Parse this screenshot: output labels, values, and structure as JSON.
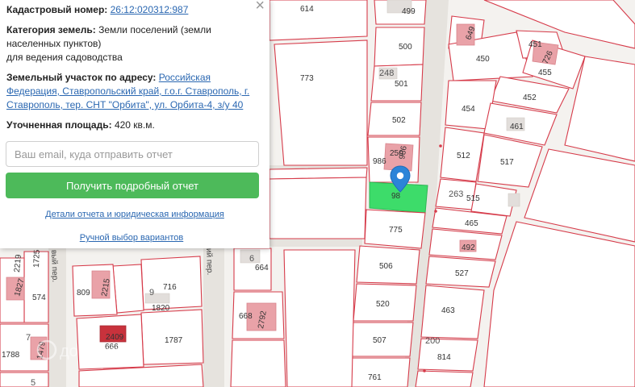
{
  "panel": {
    "cadastral_label": "Кадастровый номер:",
    "cadastral_number": "26:12:020312:987",
    "category_label": "Категория земель:",
    "category_value_1": "Земли поселений (земли",
    "category_value_2": "населенных пунктов)",
    "category_value_3": "для ведения садоводства",
    "address_label": "Земельный участок по адресу:",
    "address_line_1": "Российская",
    "address_line_2": "Федерация, Ставропольский край, г.о.г. Ставрополь, г.",
    "address_line_3": "Ставрополь, тер. СНТ \"Орбита\", ул. Орбита-4, з/у 40",
    "area_label": "Уточненная площадь:",
    "area_value": "420 кв.м.",
    "email_placeholder": "Ваш email, куда отправить отчет",
    "get_report_label": "Получить подробный отчет",
    "details_link": "Детали отчета и юридическая информация",
    "manual_link": "Ручной выбор вариантов",
    "close_symbol": "×"
  },
  "map": {
    "selected_color": "#3ddc6a",
    "plot_border_color": "#d63b4a",
    "watermark": "домклик",
    "streets": {
      "left_street": "вый пер.",
      "mid_street": "ий пер."
    },
    "plots": {
      "p614": "614",
      "p499": "499",
      "p773": "773",
      "p500": "500",
      "p248": "248",
      "p501": "501",
      "p502": "502",
      "p250": "250",
      "p986": "986",
      "p98x": "98",
      "p775": "775",
      "p506": "506",
      "p520": "520",
      "p507": "507",
      "p761": "761",
      "p451": "451",
      "p455": "455",
      "p450": "450",
      "p452": "452",
      "p454": "454",
      "p461": "461",
      "p512": "512",
      "p517": "517",
      "p263": "263",
      "p515": "515",
      "p465": "465",
      "p492": "492",
      "p527": "527",
      "p463": "463",
      "p200": "200",
      "p814": "814",
      "p6": "6",
      "p664": "664",
      "p668": "668",
      "p716": "716",
      "p9": "9",
      "p1820": "1820",
      "p809": "809",
      "p1787": "1787",
      "p2409": "2409",
      "p666": "666",
      "p574": "574",
      "p7": "7",
      "p1788": "1788",
      "p5": "5",
      "r649": "649",
      "r726": "726",
      "r2215": "2215",
      "r2219": "2219",
      "r1725": "1725",
      "r1827": "1827",
      "r2792": "2792",
      "r1479": "1479"
    }
  }
}
